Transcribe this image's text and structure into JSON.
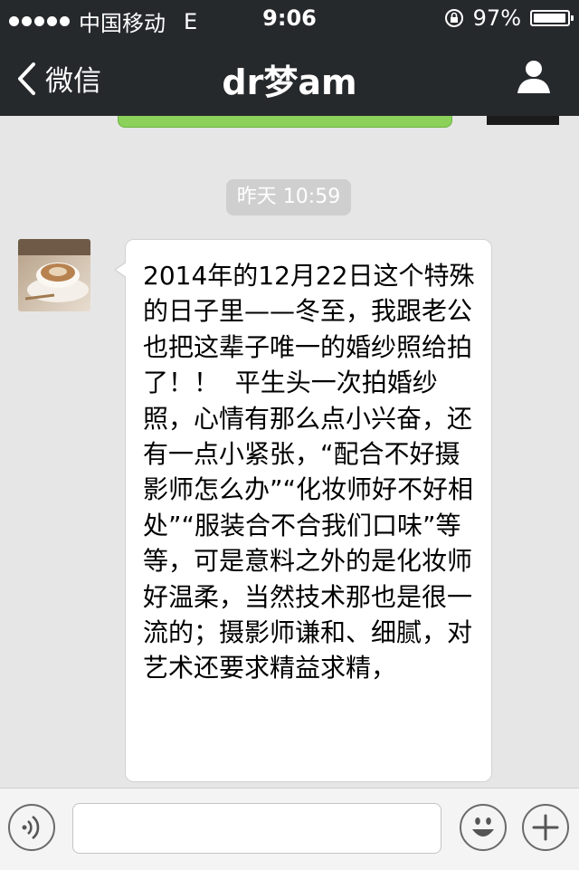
{
  "status_bar": {
    "carrier": "中国移动",
    "network": "E",
    "time": "9:06",
    "battery": "97%",
    "battery_level": 0.97
  },
  "nav": {
    "back_label": "微信",
    "title": "dr梦am"
  },
  "chat": {
    "timestamp": "昨天 10:59",
    "message": "2014年的12月22日这个特殊的日子里——冬至，我跟老公也把这辈子唯一的婚纱照给拍了！！  平生头一次拍婚纱照，心情有那么点小兴奋，还有一点小紧张，“配合不好摄影师怎么办”“化妆师好不好相处”“服装合不合我们口味”等等，可是意料之外的是化妆师好温柔，当然技术那也是很一流的；摄影师谦和、细腻，对艺术还要求精益求精，"
  },
  "input": {
    "value": ""
  },
  "icons": {
    "back": "chevron-left-icon",
    "profile": "person-icon",
    "voice": "voice-icon",
    "emoji": "emoji-icon",
    "plus": "plus-icon",
    "lock": "rotation-lock-icon"
  },
  "colors": {
    "bar_bg": "#26292c",
    "chat_bg": "#e6e6e6",
    "sent_bubble": "#8bd15a",
    "timestamp_bg": "#cfcfcf"
  }
}
